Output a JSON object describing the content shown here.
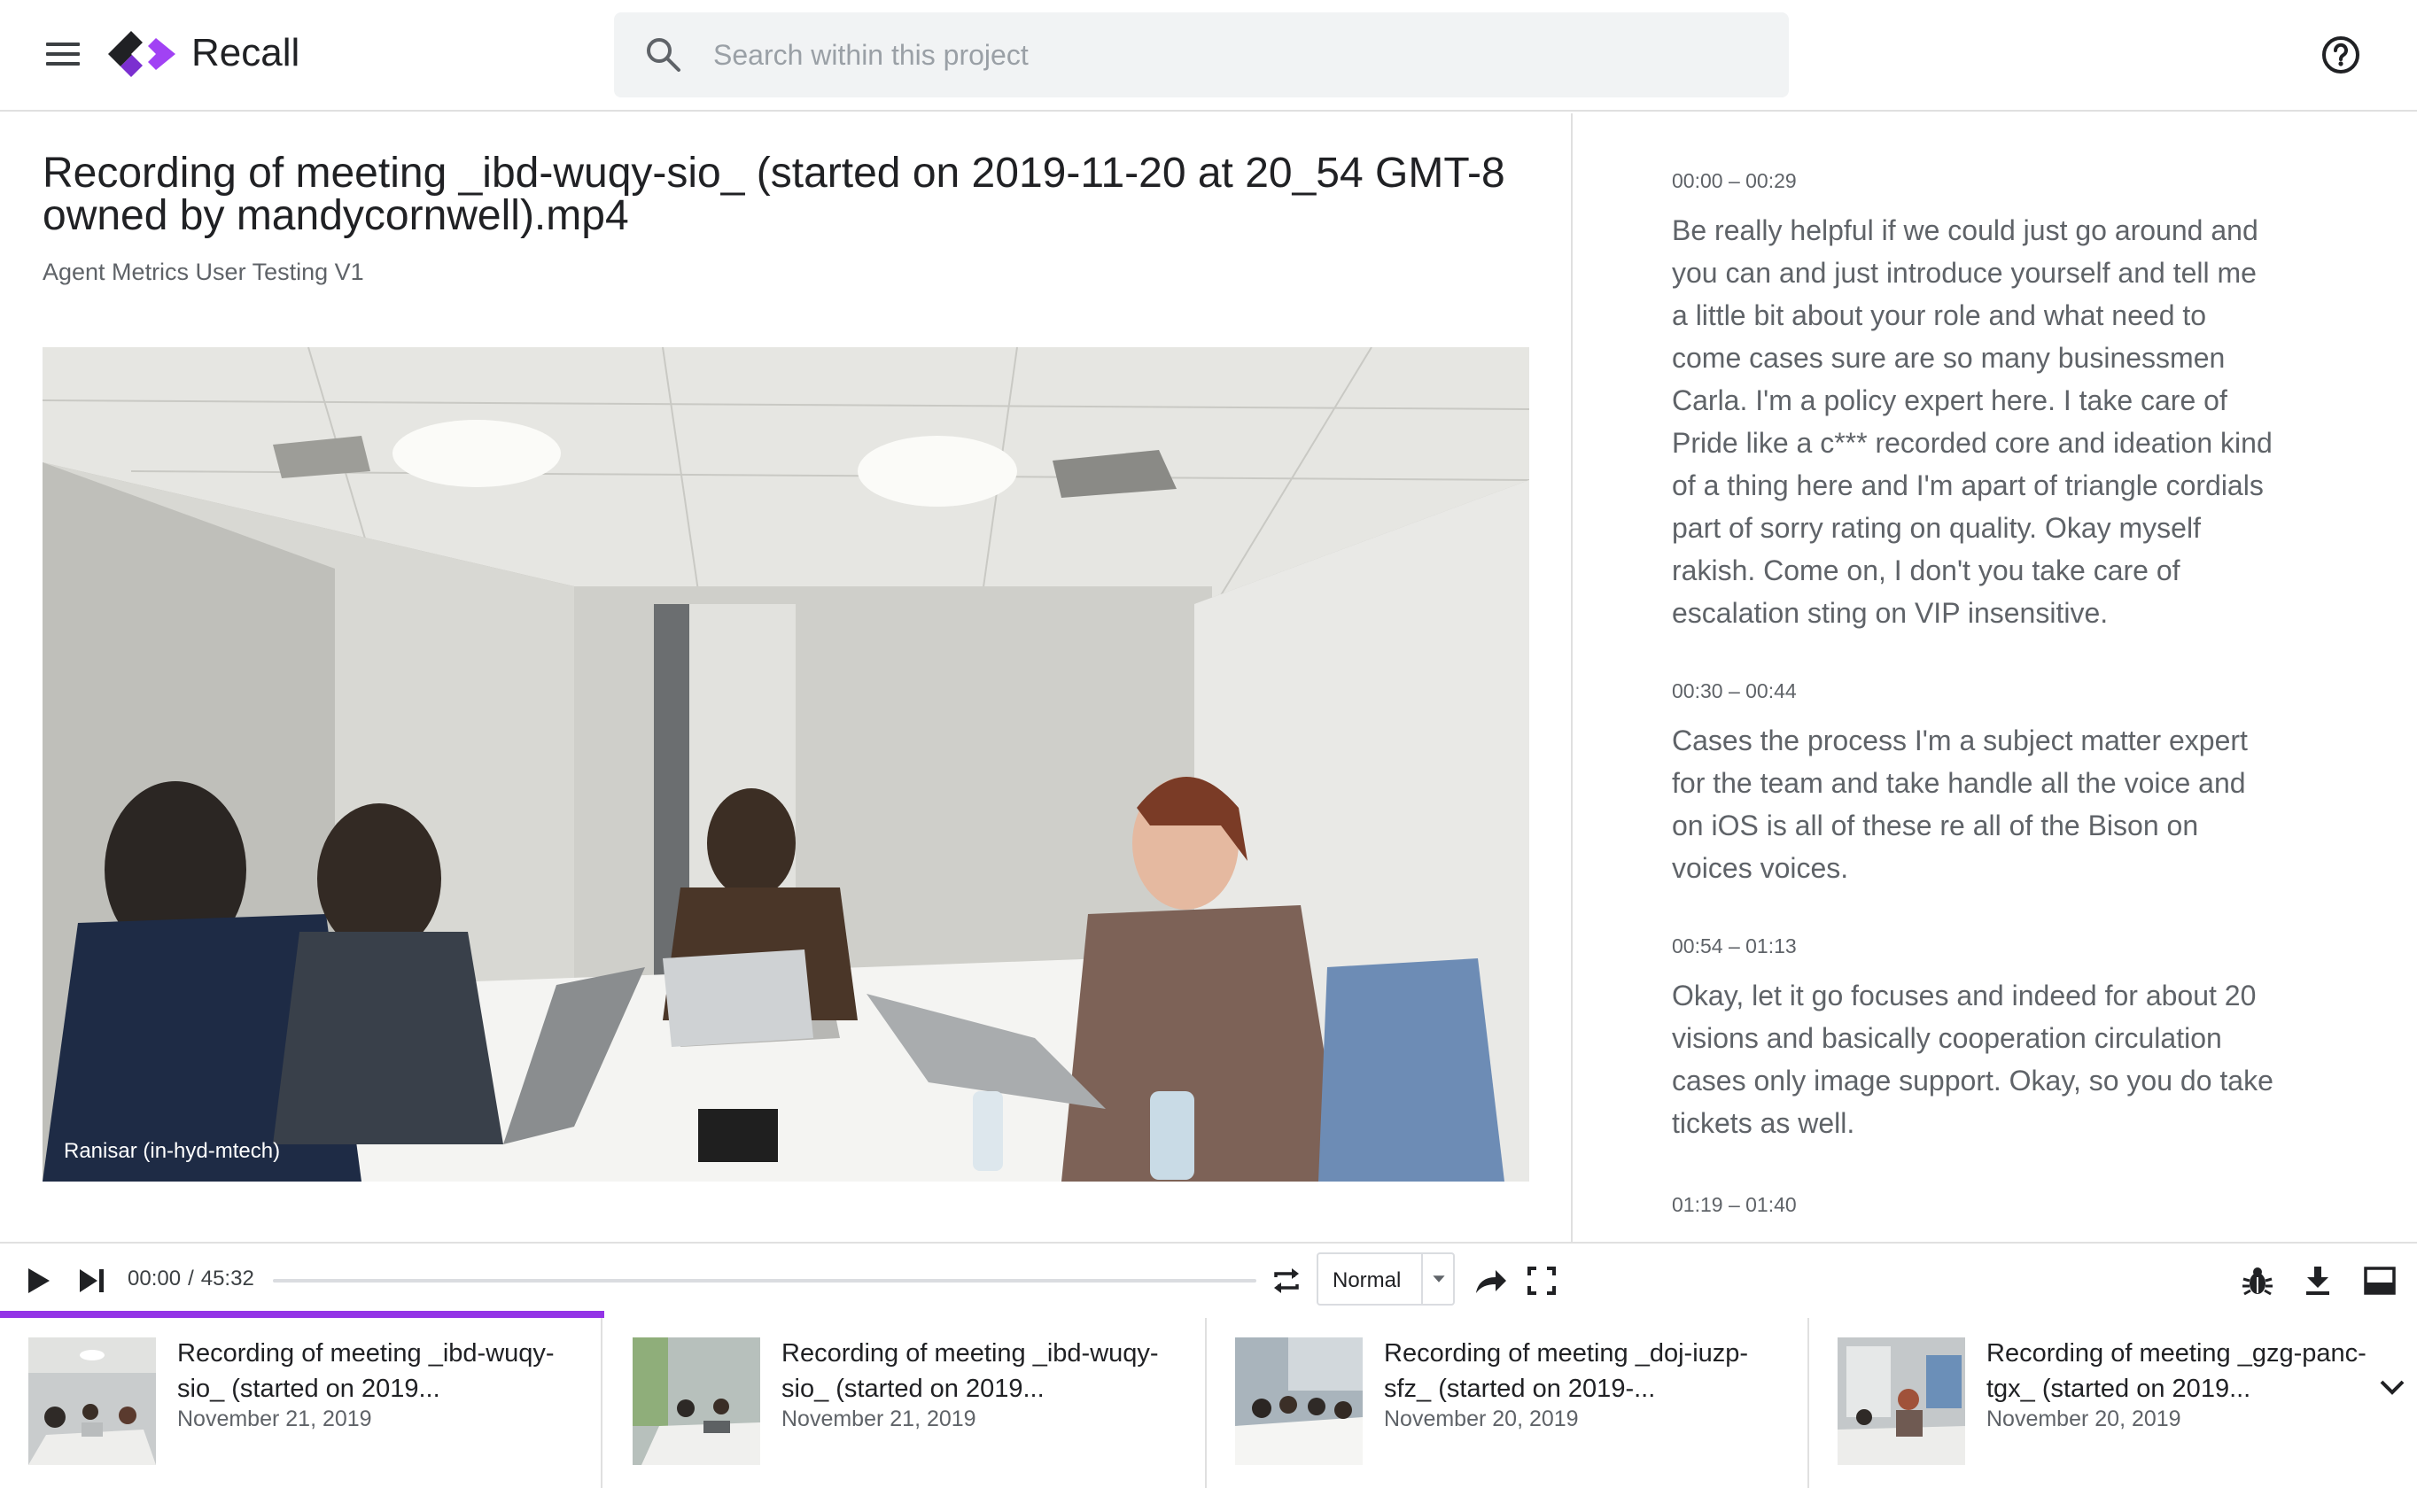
{
  "header": {
    "app_name": "Recall",
    "search_placeholder": "Search within this project"
  },
  "video": {
    "title": "Recording of meeting _ibd-wuqy-sio_ (started on 2019-11-20 at 20_54 GMT-8 owned by mandycornwell).mp4",
    "project": "Agent Metrics User Testing V1",
    "speaker_caption": "Ranisar (in-hyd-mtech)"
  },
  "transcript": [
    {
      "time": "00:00 – 00:29",
      "text": "Be really helpful if we could just go around and you can and just introduce yourself and tell me a little bit about your role and what need to come cases sure are so many businessmen Carla. I'm a policy expert here. I take care of Pride like a c*** recorded core and ideation kind of a thing here and I'm apart of triangle cordials part of sorry rating on quality. Okay myself rakish. Come on, I don't you take care of escalation sting on VIP insensitive."
    },
    {
      "time": "00:30 – 00:44",
      "text": "Cases the process I'm a subject matter expert for the team and take handle all the voice and on iOS is all of these re all of the Bison on voices voices."
    },
    {
      "time": "00:54 – 01:13",
      "text": "Okay, let it go focuses and indeed for about 20 visions and basically cooperation circulation cases only image support. Okay, so you do take tickets as well."
    },
    {
      "time": "01:19 – 01:40",
      "text": ""
    }
  ],
  "player": {
    "current_time": "00:00",
    "separator": "/",
    "duration": "45:32",
    "speed": "Normal",
    "playback_progress": 0.0,
    "queue_progress": 0.25
  },
  "related": [
    {
      "title": "Recording of meeting _ibd-wuqy-sio_ (started on 2019...",
      "date": "November 21, 2019"
    },
    {
      "title": "Recording of meeting _ibd-wuqy-sio_ (started on 2019...",
      "date": "November 21, 2019"
    },
    {
      "title": "Recording of meeting _doj-iuzp-sfz_ (started on 2019-...",
      "date": "November 20, 2019"
    },
    {
      "title": "Recording of meeting _gzg-panc-tgx_ (started on 2019...",
      "date": "November 20, 2019"
    }
  ],
  "colors": {
    "accent": "#9334e6",
    "logo_dark": "#202124",
    "logo_purple": "#9334e6"
  },
  "icons": {
    "menu": "menu-icon",
    "search": "search-icon",
    "help": "help-circle-icon",
    "play": "play-icon",
    "skip": "skip-next-icon",
    "repeat": "repeat-icon",
    "share": "share-arrow-icon",
    "fullscreen": "fullscreen-icon",
    "bug": "bug-icon",
    "download": "download-icon",
    "panel": "panel-bottom-icon",
    "expand": "chevron-down-icon"
  }
}
